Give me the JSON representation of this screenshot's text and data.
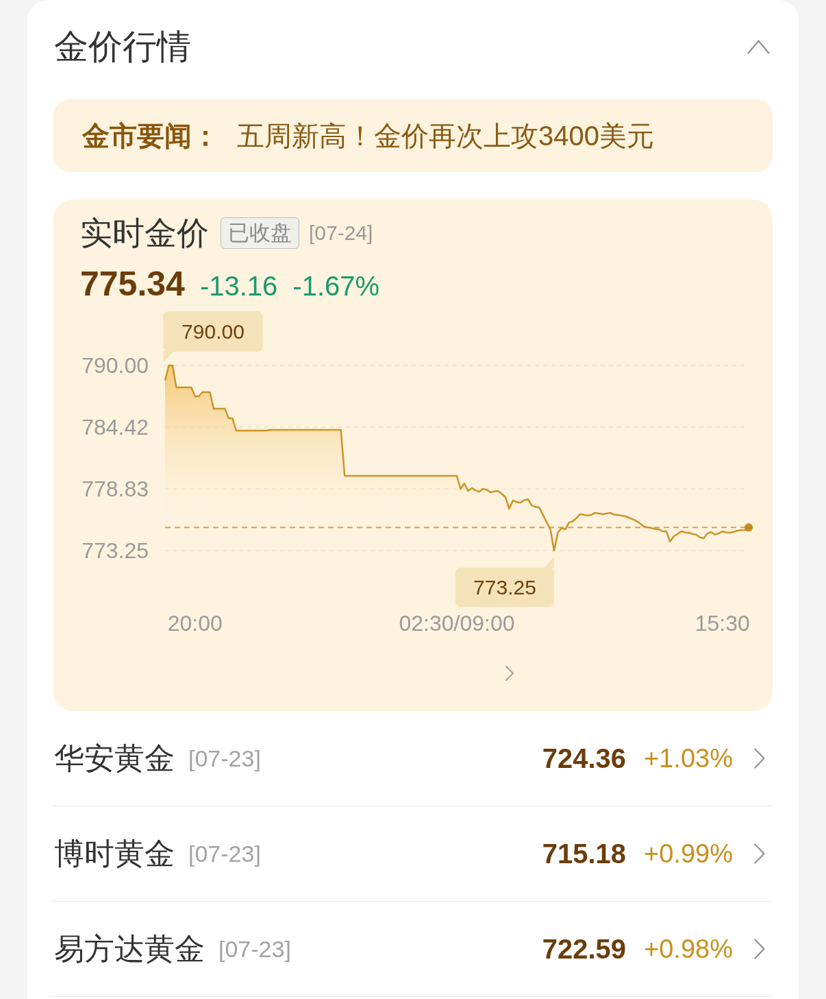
{
  "section": {
    "title": "金价行情",
    "expanded": true
  },
  "news": {
    "label": "金市要闻：",
    "headline": "五周新高！金价再次上攻3400美元"
  },
  "realtime": {
    "title": "实时金价",
    "status": "已收盘",
    "date": "[07-24]",
    "price": "775.34",
    "change": "-13.16",
    "change_percent": "-1.67%",
    "rising": false,
    "chart_data": {
      "type": "area",
      "categories": [
        null,
        null,
        null,
        null,
        null,
        null,
        null,
        null,
        "20:00",
        null,
        null,
        null,
        null,
        null,
        null,
        null,
        null,
        null,
        null,
        null,
        null,
        null,
        null,
        null,
        null,
        null,
        null,
        null,
        null,
        null,
        null,
        null,
        null,
        null,
        null,
        null,
        null,
        null,
        null,
        null,
        null,
        null,
        null,
        null,
        null,
        null,
        null,
        null,
        null,
        null,
        null,
        null,
        null,
        null,
        null,
        null,
        null,
        null,
        null,
        null,
        null,
        null,
        null,
        null,
        null,
        null,
        null,
        null,
        null,
        null,
        null,
        null,
        null,
        null,
        null,
        null,
        null,
        null,
        "02:30/09:00",
        null,
        null,
        null,
        null,
        null,
        null,
        null,
        null,
        null,
        null,
        null,
        null,
        null,
        null,
        null,
        null,
        null,
        null,
        null,
        null,
        null,
        null,
        null,
        null,
        null,
        null,
        null,
        null,
        null,
        null,
        null,
        null,
        null,
        null,
        null,
        null,
        null,
        null,
        null,
        null,
        null,
        null,
        null,
        null,
        null,
        null,
        null,
        null,
        null,
        null,
        null,
        null,
        null,
        null,
        null,
        null,
        null,
        null,
        null,
        null,
        null,
        null,
        null,
        null,
        null,
        null,
        null,
        null,
        null,
        null,
        "15:30",
        null,
        null,
        null,
        null,
        null,
        null,
        null
      ],
      "values": [
        788.64,
        790.0,
        790.0,
        788.01,
        788.01,
        788.01,
        788.01,
        788.01,
        787.21,
        787.21,
        787.58,
        787.58,
        787.58,
        786.09,
        786.09,
        786.09,
        786.09,
        785.22,
        785.22,
        784.11,
        784.11,
        784.11,
        784.11,
        784.11,
        784.11,
        784.11,
        784.11,
        784.11,
        784.17,
        784.17,
        784.17,
        784.17,
        784.17,
        784.17,
        784.17,
        784.17,
        784.17,
        784.17,
        784.17,
        784.17,
        784.17,
        784.17,
        784.17,
        784.17,
        784.17,
        784.17,
        784.17,
        784.17,
        780.01,
        780.01,
        780.01,
        780.01,
        780.01,
        780.01,
        780.01,
        780.01,
        780.01,
        780.01,
        780.01,
        780.01,
        780.01,
        780.01,
        780.01,
        780.01,
        780.01,
        780.01,
        780.01,
        780.01,
        780.01,
        780.01,
        780.01,
        780.01,
        780.01,
        780.01,
        780.01,
        780.01,
        780.01,
        780.01,
        780.01,
        778.83,
        779.33,
        778.65,
        778.9,
        778.7,
        778.58,
        778.83,
        778.75,
        778.52,
        778.6,
        778.65,
        778.4,
        778.09,
        777.03,
        777.78,
        777.65,
        777.59,
        777.8,
        777.9,
        777.34,
        777.2,
        777.16,
        776.5,
        775.8,
        775.2,
        773.25,
        774.86,
        775.3,
        775.17,
        775.79,
        775.9,
        776.2,
        776.54,
        776.5,
        776.41,
        776.5,
        776.66,
        776.6,
        776.54,
        776.6,
        776.66,
        776.5,
        776.48,
        776.41,
        776.35,
        776.23,
        776.1,
        775.92,
        775.7,
        775.42,
        775.35,
        775.3,
        775.2,
        775.17,
        775.0,
        774.99,
        774.06,
        774.55,
        774.75,
        774.99,
        774.9,
        774.86,
        774.75,
        774.68,
        774.45,
        774.37,
        774.8,
        774.92,
        774.7,
        774.8,
        774.99,
        774.9,
        774.86,
        774.95,
        775.05,
        775.1,
        775.11,
        775.34
      ],
      "ylim": [
        773.25,
        790.0
      ],
      "yticks": [
        {
          "value": 790.0,
          "label": "790.00"
        },
        {
          "value": 784.42,
          "label": "784.42"
        },
        {
          "value": 778.83,
          "label": "778.83"
        },
        {
          "value": 773.25,
          "label": "773.25"
        }
      ],
      "annotations": [
        "790.00",
        "773.25"
      ],
      "ref_lines": [
        {
          "axis": "y",
          "value": 775.34
        }
      ]
    }
  },
  "funds": [
    {
      "name": "华安黄金",
      "date": "[07-23]",
      "price": "724.36",
      "change_percent": "+1.03%",
      "rising": true
    },
    {
      "name": "博时黄金",
      "date": "[07-23]",
      "price": "715.18",
      "change_percent": "+0.99%",
      "rising": true
    },
    {
      "name": "易方达黄金",
      "date": "[07-23]",
      "price": "722.59",
      "change_percent": "+0.98%",
      "rising": true
    }
  ]
}
